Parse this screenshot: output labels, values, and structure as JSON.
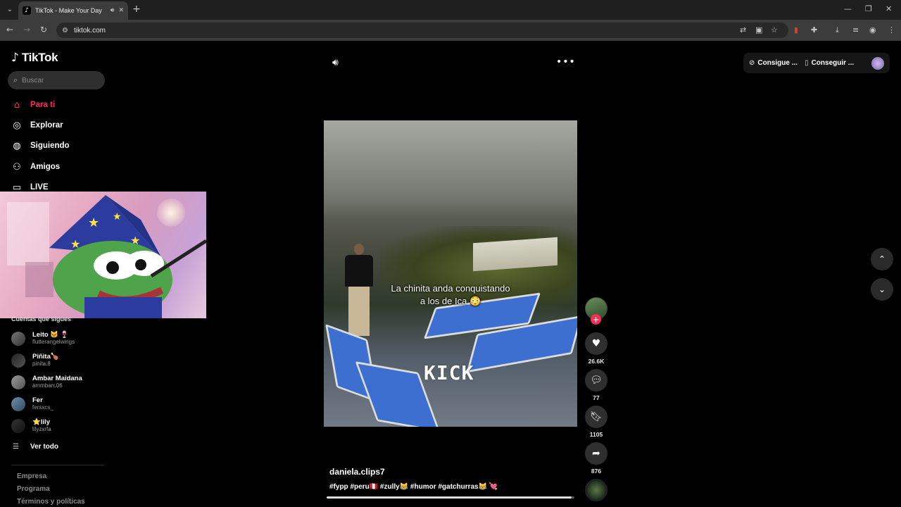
{
  "browser": {
    "tab_title": "TikTok - Make Your Day",
    "url": "tiktok.com"
  },
  "sidebar": {
    "logo_text": "TikTok",
    "search_placeholder": "Buscar",
    "nav": [
      {
        "label": "Para ti",
        "icon": "home-icon",
        "active": true
      },
      {
        "label": "Explorar",
        "icon": "compass-icon"
      },
      {
        "label": "Siguiendo",
        "icon": "following-icon"
      },
      {
        "label": "Amigos",
        "icon": "friends-icon"
      },
      {
        "label": "LIVE",
        "icon": "live-icon"
      }
    ],
    "following_title": "Cuentas que sigues",
    "accounts": [
      {
        "name": "Leito 🐱 🍷",
        "handle": "flutterangelwings"
      },
      {
        "name": "Piñita🍗",
        "handle": "pinita.8"
      },
      {
        "name": "Ambar Maidana",
        "handle": "ammbarr.06"
      },
      {
        "name": "Fer",
        "handle": "fersxcs_"
      },
      {
        "name": "⭐lily",
        "handle": "lilyzxrfa"
      }
    ],
    "see_all": "Ver todo",
    "footer": [
      "Empresa",
      "Programa",
      "Términos y políticas"
    ]
  },
  "video": {
    "caption_line1": "La chinita anda conquistando",
    "caption_line2": "a los de Ica 😳",
    "watermark": "KICK",
    "author": "daniela.clips7",
    "description": "#fypp #peru🇵🇪 #zully😹 #humor #gatchurras😹 💘",
    "progress": 0.99
  },
  "actions": {
    "likes": "26.6K",
    "comments": "77",
    "saves": "1105",
    "shares": "876"
  },
  "topbar": {
    "coins_label": "Consigue ...",
    "app_label": "Conseguir ..."
  }
}
